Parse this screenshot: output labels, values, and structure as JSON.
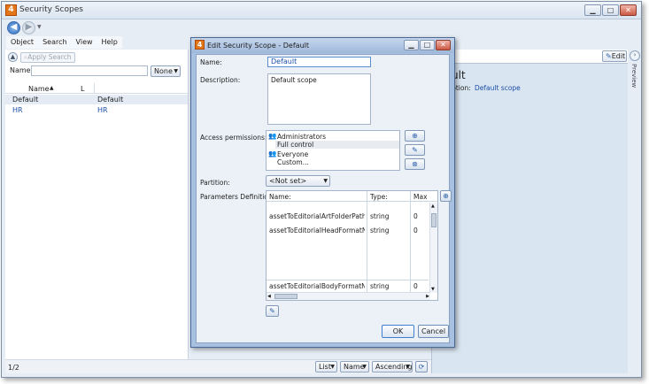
{
  "window": {
    "title": "Security Scopes",
    "min": "▁",
    "max": "□",
    "close": "✕"
  },
  "menu": [
    "Object",
    "Search",
    "View",
    "Help"
  ],
  "search": {
    "apply_label": "Apply Search",
    "name_label": "Name:",
    "name_value": "",
    "filter_value": "None"
  },
  "list": {
    "columns": [
      "Name",
      "L"
    ],
    "group_header": [
      "Default",
      "Default"
    ],
    "rows": [
      [
        "HR",
        "HR"
      ]
    ],
    "status": "1/2",
    "view_mode": "List",
    "sort_field": "Name",
    "sort_order": "Ascending"
  },
  "right": {
    "edit_label": "Edit",
    "heading": "ult",
    "desc_label": "iption:",
    "desc_value": "Default scope",
    "preview_label": "Preview"
  },
  "dialog": {
    "title": "Edit Security Scope - Default",
    "name_label": "Name:",
    "name_value": "Default",
    "description_label": "Description:",
    "description_value": "Default scope",
    "access_label": "Access permissions:",
    "permissions": [
      {
        "principal": "Administrators",
        "right": "Full control"
      },
      {
        "principal": "Everyone",
        "right": "Custom..."
      }
    ],
    "partition_label": "Partition:",
    "partition_value": "<Not set>",
    "params_label": "Parameters Definition:",
    "param_columns": [
      "Name:",
      "Type:",
      "Max"
    ],
    "params": [
      {
        "name": "assetToEditorialArtFolderPath",
        "type": "string",
        "max": "0"
      },
      {
        "name": "assetToEditorialHeadFormatName",
        "type": "string",
        "max": "0"
      },
      {
        "name": "assetToEditorialBodyFormatName",
        "type": "string",
        "max": "0"
      }
    ],
    "ok_label": "OK",
    "cancel_label": "Cancel"
  },
  "colors": {
    "link": "#1c4fa8",
    "accent": "#e4761a"
  }
}
